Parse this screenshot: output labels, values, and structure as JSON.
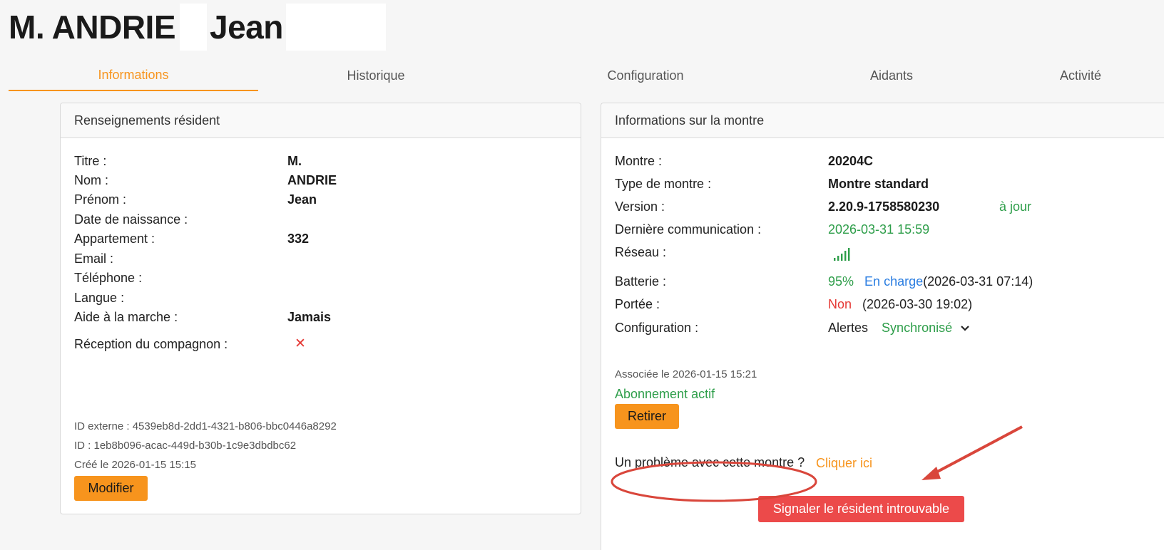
{
  "header": {
    "title_prefix": "M. ANDRIE",
    "title_first": "Jean"
  },
  "tabs": [
    {
      "label": "Informations"
    },
    {
      "label": "Historique"
    },
    {
      "label": "Configuration"
    },
    {
      "label": "Aidants"
    },
    {
      "label": "Activité"
    }
  ],
  "resident": {
    "heading": "Renseignements résident",
    "fields": [
      {
        "label": "Titre :",
        "value": "M."
      },
      {
        "label": "Nom :",
        "value": "ANDRIE"
      },
      {
        "label": "Prénom :",
        "value": "Jean"
      },
      {
        "label": "Date de naissance :",
        "value": ""
      },
      {
        "label": "Appartement :",
        "value": "332"
      },
      {
        "label": "Email :",
        "value": ""
      },
      {
        "label": "Téléphone :",
        "value": ""
      },
      {
        "label": "Langue :",
        "value": ""
      },
      {
        "label": "Aide à la marche :",
        "value": "Jamais"
      }
    ],
    "companion_label": "Réception du compagnon :",
    "companion_icon": "✕",
    "external_id": "ID externe : 4539eb8d-2dd1-4321-b806-bbc0446a8292",
    "id": "ID : 1eb8b096-acac-449d-b30b-1c9e3dbdbc62",
    "created": "Créé le 2026-01-15 15:15",
    "modify_label": "Modifier"
  },
  "watch": {
    "heading": "Informations sur la montre",
    "montre_label": "Montre :",
    "montre_value": "20204C",
    "type_label": "Type de montre :",
    "type_value": "Montre standard",
    "version_label": "Version :",
    "version_value": "2.20.9-1758580230",
    "version_status": "à jour",
    "lastcomm_label": "Dernière communication :",
    "lastcomm_value": "2026-03-31 15:59",
    "network_label": "Réseau :",
    "battery_label": "Batterie :",
    "battery_percent": "95%",
    "battery_status": "En charge",
    "battery_time": "(2026-03-31 07:14)",
    "worn_label": "Portée :",
    "worn_value": "Non",
    "worn_time": "(2026-03-30 19:02)",
    "config_label": "Configuration :",
    "config_alerts": "Alertes",
    "config_status": "Synchronisé",
    "associated": "Associée le 2026-01-15 15:21",
    "subscription": "Abonnement actif",
    "remove_label": "Retirer",
    "problem_text": "Un problème avec cette montre ?",
    "problem_link": "Cliquer ici",
    "report_label": "Signaler le résident introuvable"
  },
  "colors": {
    "accent": "#f7941d",
    "green": "#2e9e4a",
    "red": "#e53935",
    "blue": "#2a7de1",
    "annotation": "#d9463b"
  }
}
